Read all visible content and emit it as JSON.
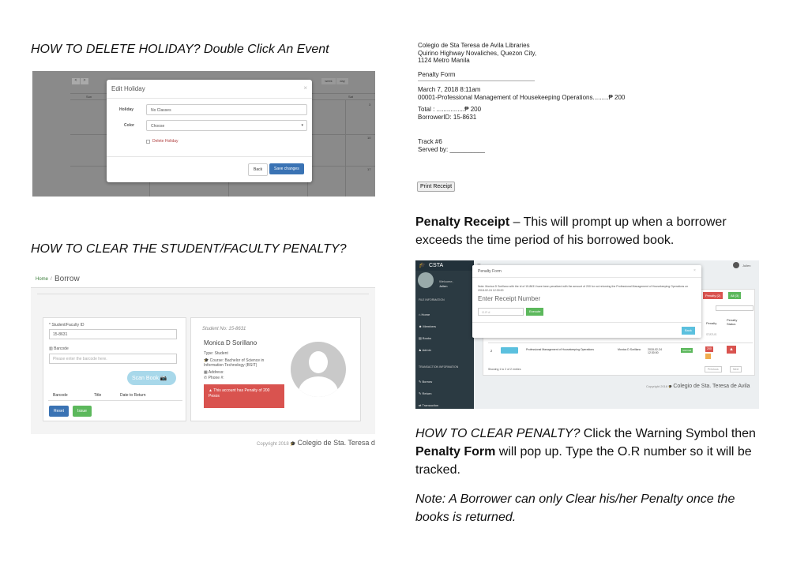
{
  "left_column": {
    "heading1": "HOW TO DELETE HOLIDAY? Double Click An Event",
    "heading2": "HOW TO CLEAR THE STUDENT/FACULTY PENALTY?"
  },
  "holiday_modal": {
    "calendar_nav": [
      "<",
      ">"
    ],
    "calendar_views": [
      "week",
      "day"
    ],
    "calendar_days": [
      "Sun",
      "Sat"
    ],
    "calendar_dates": [
      "3",
      "10",
      "17"
    ],
    "title": "Edit Holiday",
    "close": "×",
    "holiday_label": "Holiday",
    "holiday_value": "No Classes",
    "color_label": "Color",
    "color_value": "Choose",
    "delete_label": "Delete Holiday",
    "back_btn": "Back",
    "save_btn": "Save changes"
  },
  "borrow_screen": {
    "breadcrumb_home": "Home",
    "breadcrumb_sep": "/",
    "title": "Borrow",
    "id_label": "* Student/Faculty ID",
    "id_value": "15-8631",
    "barcode_label": "Barcode",
    "barcode_placeholder": "Please enter the barcode here.",
    "scan_btn": "Scan Book",
    "col_barcode": "Barcode",
    "col_title": "Title",
    "col_date": "Date to Return",
    "reset_btn": "Reset",
    "issue_btn": "Issue",
    "student_no": "Student No: 15-8631",
    "name": "Monica D Sorillano",
    "type": "Type: Student",
    "course": "Course: Bachelor of Science in Information Technology (BSIT)",
    "address": "Address:",
    "phone": "Phone #:",
    "alert": "This account has Penalty of 200 Pesos",
    "footer_copy": "Copyright 2018",
    "footer_school": "Colegio de Sta. Teresa d"
  },
  "receipt": {
    "line1": "Colegio de Sta Teresa de Avila Libraries",
    "line2": "Quirino Highway Novaliches, Quezon City,",
    "line3": "1124 Metro Manila",
    "form_title": "Penalty Form",
    "date": "March 7, 2018 8:11am",
    "item": "00001-Professional Management of Housekeeping Operations.........₱ 200",
    "total": "Total : ................₱ 200",
    "borrower": "BorrowerID: 15-8631",
    "track": "Track #6",
    "served": "Served by: __________",
    "print_btn": "Print Receipt"
  },
  "right_column": {
    "receipt_bold": "Penalty Receipt",
    "receipt_text": " – This will prompt up when a borrower exceeds the time period of his borrowed book.",
    "clear_italic": "HOW TO CLEAR PENALTY?",
    "clear_text1": "  Click the Warning Symbol then ",
    "clear_bold": "Penalty Form",
    "clear_text2": " will pop up. Type the O.R number  so it will be tracked.",
    "note": "Note: A Borrower can only Clear his/her Penalty once the books is returned."
  },
  "penalty_screen": {
    "brand": "CSTA",
    "welcome": "Welcome,",
    "user": "Julien",
    "file_info": "FILE INFORMATION",
    "nav_home": "Home",
    "nav_members": "Members",
    "nav_books": "Books",
    "nav_admin": "Admin",
    "trans_info": "TRANSACTION INFORMATION",
    "nav_borrow": "Borrow",
    "nav_return": "Return",
    "nav_transaction": "Transaction",
    "topbar_user": "Julien",
    "modal_title": "Penalty Form",
    "modal_note": "Note: Monica D Sorillano with the id of 15-8631 have been penalized with the amount of 200 for not returning the Professional Management of Housekeeping Operations on 2018-02-24 12:30:00",
    "receipt_label": "Enter Receipt Number",
    "receipt_placeholder": "O.R #",
    "execute_btn": "Execute",
    "back_btn": "Back",
    "tab_penalty": "Penalty (2)",
    "tab_all": "All (3)",
    "col_penalty": "Penalty",
    "col_status": "Penalty Status",
    "row_num": "2",
    "row_book": "Professional Management of Housekeeping Operations",
    "row_name": "Monica D Sorillano",
    "row_date": "2018-02-24 12:30:00",
    "row_badge": "returned",
    "row_penalty": "200",
    "row_status": "STATUS",
    "showing": "Showing 1 to 2 of 2 entries",
    "prev": "Previous",
    "next": "Next",
    "footer": "Copyright 2018",
    "footer_school": "Colegio de Sta. Teresa de Avila"
  }
}
